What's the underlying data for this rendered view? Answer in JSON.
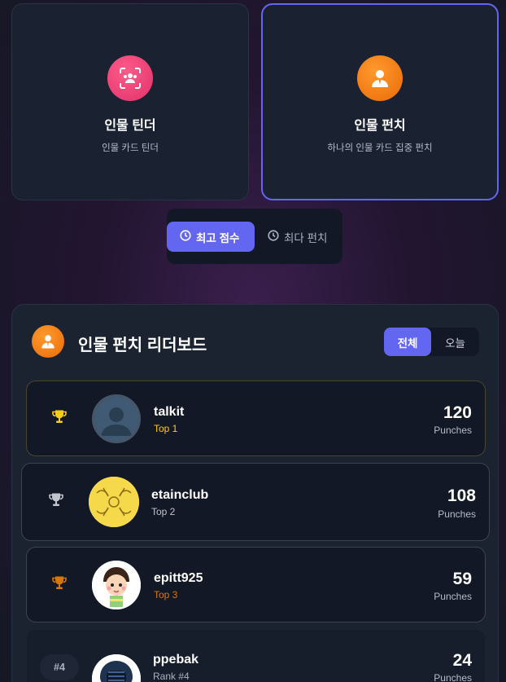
{
  "modes": [
    {
      "title": "인물 틴더",
      "subtitle": "인물 카드 틴더",
      "icon": "face-scan-icon",
      "color": "#ec4077"
    },
    {
      "title": "인물 펀치",
      "subtitle": "하나의 인물 카드 집중 펀치",
      "icon": "person-icon",
      "color": "#f97316",
      "selected": true
    }
  ],
  "sort": {
    "active_label": "최고 점수",
    "inactive_label": "최다 펀치"
  },
  "leaderboard": {
    "title": "인물 펀치 리더보드",
    "period_all": "전체",
    "period_today": "오늘",
    "entries": [
      {
        "username": "talkit",
        "rank_label": "Top 1",
        "score": "120",
        "unit": "Punches",
        "trophy_color": "#facc15",
        "rank_color": "#facc15"
      },
      {
        "username": "etainclub",
        "rank_label": "Top 2",
        "score": "108",
        "unit": "Punches",
        "trophy_color": "#c0c4cc",
        "rank_color": "#c0c4cc"
      },
      {
        "username": "epitt925",
        "rank_label": "Top 3",
        "score": "59",
        "unit": "Punches",
        "trophy_color": "#d97706",
        "rank_color": "#d97706"
      },
      {
        "username": "ppebak",
        "rank_label": "Rank #4",
        "rank_badge": "#4",
        "score": "24",
        "unit": "Punches",
        "rank_color": "#aab2c2"
      }
    ]
  },
  "colors": {
    "accent": "#6366f1",
    "gold": "#facc15",
    "silver": "#c0c4cc",
    "bronze": "#d97706"
  }
}
